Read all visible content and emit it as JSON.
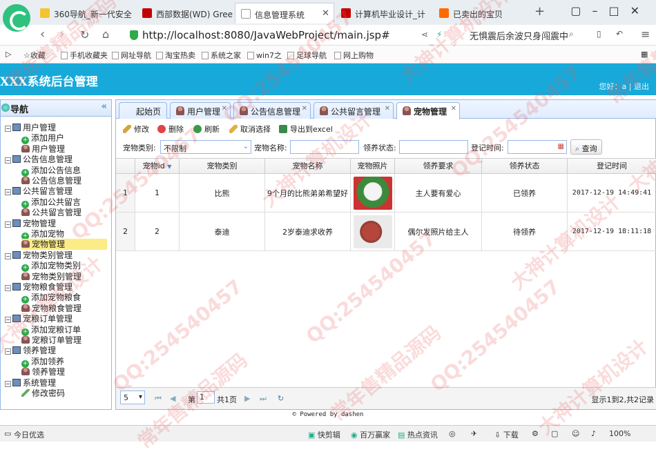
{
  "browser": {
    "tabs": [
      {
        "label": "360导航_新一代安全",
        "color": "#1b8a3a"
      },
      {
        "label": "西部数据(WD) Gree",
        "color": "#c40000"
      },
      {
        "label": "信息管理系统",
        "color": "#ffffff"
      },
      {
        "label": "计算机毕业设计_计",
        "color": "#c40000"
      },
      {
        "label": "已卖出的宝贝",
        "color": "#ff6a00"
      }
    ],
    "url": "http://localhost:8080/JavaWebProject/main.jsp#",
    "news": "无惧震后余波只身闯震中",
    "bookmarks": [
      "收藏",
      "手机收藏夹",
      "网址导航",
      "淘宝热卖",
      "系统之家",
      "win7之",
      "足球导航",
      "网上购物"
    ]
  },
  "app": {
    "title": "XXX系统后台管理",
    "user_greeting": "您好：a",
    "logout": "退出"
  },
  "sidebar": {
    "title": "导航",
    "groups": [
      {
        "label": "用户管理",
        "items": [
          "添加用户",
          "用户管理"
        ]
      },
      {
        "label": "公告信息管理",
        "items": [
          "添加公告信息",
          "公告信息管理"
        ]
      },
      {
        "label": "公共留言管理",
        "items": [
          "添加公共留言",
          "公共留言管理"
        ]
      },
      {
        "label": "宠物管理",
        "items": [
          "添加宠物",
          "宠物管理"
        ]
      },
      {
        "label": "宠物类别管理",
        "items": [
          "添加宠物类别",
          "宠物类别管理"
        ]
      },
      {
        "label": "宠物粮食管理",
        "items": [
          "添加宠物粮食",
          "宠物粮食管理"
        ]
      },
      {
        "label": "宠粮订单管理",
        "items": [
          "添加宠粮订单",
          "宠粮订单管理"
        ]
      },
      {
        "label": "领养管理",
        "items": [
          "添加领养",
          "领养管理"
        ]
      },
      {
        "label": "系统管理",
        "items": [
          "修改密码"
        ]
      }
    ],
    "selected": "宠物管理"
  },
  "main": {
    "tabs": [
      "起始页",
      "用户管理",
      "公告信息管理",
      "公共留言管理",
      "宠物管理"
    ],
    "toolbar": [
      "修改",
      "删除",
      "刷新",
      "取消选择",
      "导出到excel"
    ],
    "filters": {
      "category_label": "宠物类别:",
      "category_value": "不限制",
      "name_label": "宠物名称:",
      "status_label": "领养状态:",
      "date_label": "登记时间:",
      "search_label": "查询"
    },
    "columns": [
      "宠物id",
      "宠物类别",
      "宠物名称",
      "宠物照片",
      "领养要求",
      "领养状态",
      "登记时间"
    ],
    "rows": [
      {
        "rownum": "1",
        "id": "1",
        "category": "比熊",
        "name": "9个月的比熊弟弟希望好",
        "requirement": "主人要有爱心",
        "status": "已领养",
        "date": "2017-12-19 14:49:41"
      },
      {
        "rownum": "2",
        "id": "2",
        "category": "泰迪",
        "name": "2岁泰迪求收养",
        "requirement": "偶尔发照片给主人",
        "status": "待领养",
        "date": "2017-12-19 18:11:18"
      }
    ],
    "pager": {
      "page_size": "5",
      "page_prefix": "第",
      "page_value": "1",
      "page_suffix": "共1页",
      "summary": "显示1到2,共2记录"
    }
  },
  "footer": "© Powered by dashen",
  "statusbar": {
    "left": "今日优选",
    "items": [
      "快剪辑",
      "百万赢家",
      "热点资讯",
      "下载",
      "100%"
    ]
  },
  "watermark": [
    "QQ:254540457",
    "大神计算机设计",
    "常年售精品源码"
  ]
}
